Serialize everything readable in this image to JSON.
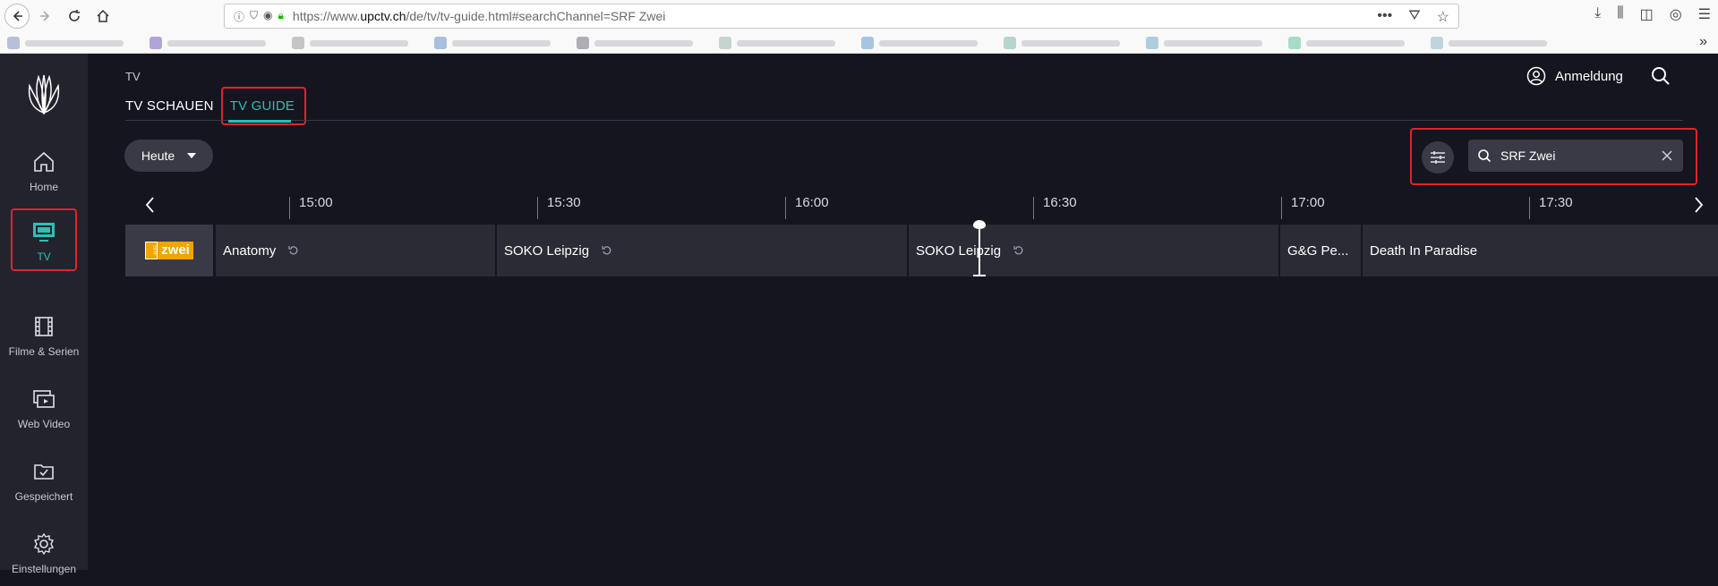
{
  "browser": {
    "url_prefix": "https://www.",
    "url_domain": "upctv.ch",
    "url_suffix": "/de/tv/tv-guide.html#searchChannel=SRF Zwei"
  },
  "sidebar": {
    "items": [
      {
        "label": "Home",
        "icon": "home-icon"
      },
      {
        "label": "TV",
        "icon": "tv-icon"
      },
      {
        "label": "Filme & Serien",
        "icon": "film-icon"
      },
      {
        "label": "Web Video",
        "icon": "web-video-icon"
      },
      {
        "label": "Gespeichert",
        "icon": "folder-check-icon"
      },
      {
        "label": "Einstellungen",
        "icon": "gear-icon"
      }
    ]
  },
  "header": {
    "section": "TV",
    "tabs": [
      {
        "label": "TV SCHAUEN"
      },
      {
        "label": "TV GUIDE"
      }
    ],
    "login_label": "Anmeldung"
  },
  "controls": {
    "day_label": "Heute",
    "search_value": "SRF Zwei"
  },
  "timeline": {
    "times": [
      "15:00",
      "15:30",
      "16:00",
      "16:30",
      "17:00",
      "17:30"
    ]
  },
  "channel": {
    "logo_left": "SRF",
    "logo_right": "zwei",
    "programs": [
      {
        "title": "Anatomy",
        "replay": true
      },
      {
        "title": "SOKO Leipzig",
        "replay": true
      },
      {
        "title": "SOKO Leipzig",
        "replay": true
      },
      {
        "title": "G&G Pe...",
        "replay": false
      },
      {
        "title": "Death In Paradise",
        "replay": false
      }
    ]
  },
  "colors": {
    "accent": "#2fbfb5",
    "highlight": "#e0232d",
    "background": "#15151f"
  }
}
